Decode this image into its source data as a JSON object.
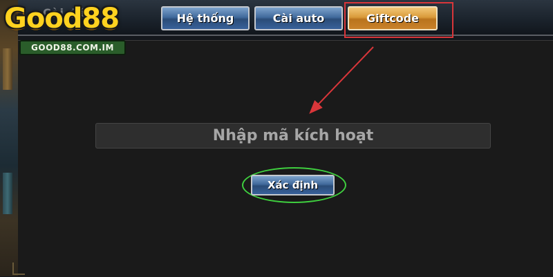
{
  "header": {
    "settings_title": "Cài đặt"
  },
  "logo": {
    "name": "Good88",
    "domain": "GOOD88.COM.IM"
  },
  "tabs": [
    {
      "label": "Hệ thống"
    },
    {
      "label": "Cài auto"
    },
    {
      "label": "Giftcode",
      "active": true
    }
  ],
  "giftcode": {
    "input_value": "",
    "input_placeholder": "Nhập mã kích hoạt",
    "confirm_label": "Xác định"
  },
  "colors": {
    "tab_blue": "#416a9c",
    "tab_active": "#d99a3a",
    "tab_highlight": "#d9363a",
    "confirm_highlight": "#3fcf3f",
    "panel_bg": "#1a1a1a"
  }
}
